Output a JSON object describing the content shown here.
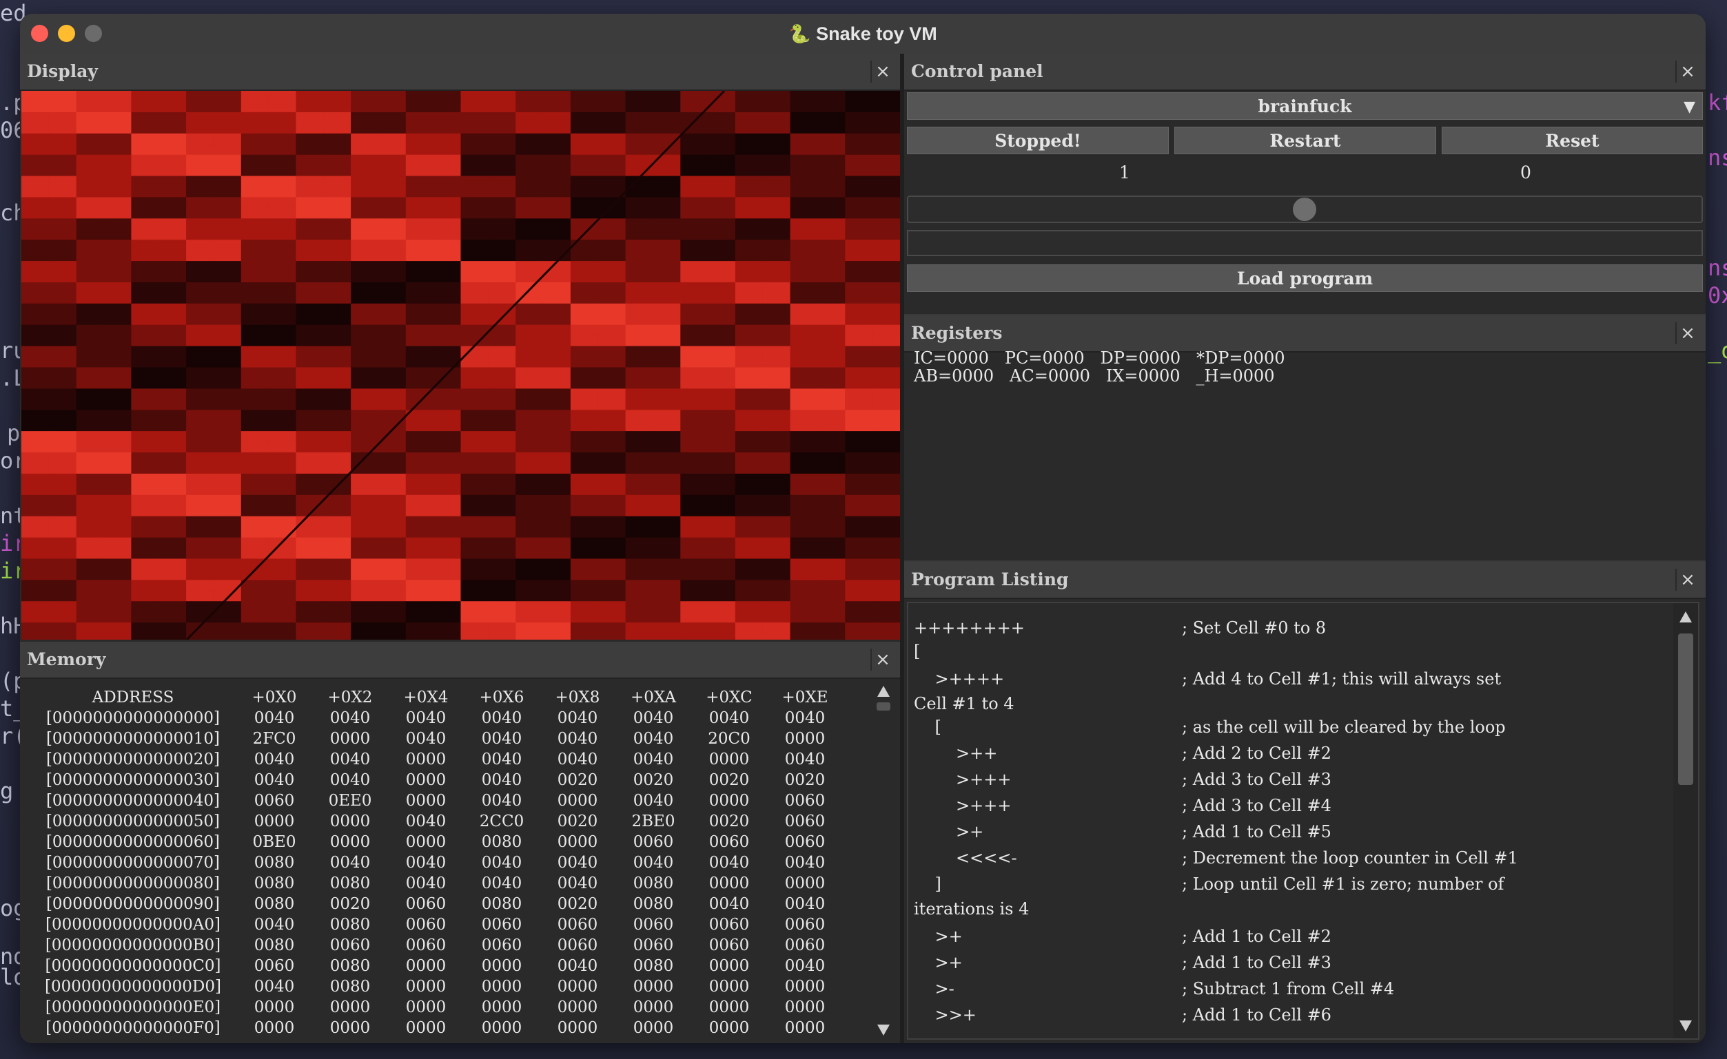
{
  "background_editor": {
    "fragments": [
      "ed",
      ".p",
      "06",
      "ch",
      "ru",
      ".L",
      "p",
      "or",
      "nt",
      "ir",
      "ir",
      "hH",
      "(p",
      "t_",
      "r(",
      "g",
      "og",
      "nd",
      "lo"
    ],
    "right_fragments": [
      "kf",
      "ns",
      "ns",
      "0x",
      "_o"
    ]
  },
  "window": {
    "title": "Snake toy VM",
    "title_icon": "snake-icon"
  },
  "display": {
    "title": "Display",
    "close_label": "×",
    "heatmap_colors": [
      "#160404",
      "#2a0606",
      "#4a0a08",
      "#7a100c",
      "#a8170f",
      "#d42a1f",
      "#e8382a"
    ]
  },
  "control_panel": {
    "title": "Control panel",
    "close_label": "×",
    "language_select": "brainfuck",
    "buttons": {
      "stopped": "Stopped!",
      "restart": "Restart",
      "reset": "Reset"
    },
    "left_value": "1",
    "right_value": "0",
    "slider_value": 0.5,
    "load_program": "Load program"
  },
  "registers": {
    "title": "Registers",
    "close_label": "×",
    "line1": "IC=0000   PC=0000   DP=0000   *DP=0000",
    "line2": "AB=0000   AC=0000   IX=0000   _H=0000"
  },
  "listing": {
    "title": "Program Listing",
    "close_label": "×",
    "lines": [
      {
        "code": "++++++++",
        "comment": "; Set Cell #0 to 8"
      },
      {
        "code": "[",
        "comment": ""
      },
      {
        "code": "    >++++",
        "comment": "; Add 4 to Cell #1; this will always set"
      },
      {
        "code": "Cell #1 to 4",
        "comment": ""
      },
      {
        "code": "    [",
        "comment": "; as the cell will be cleared by the loop"
      },
      {
        "code": "        >++",
        "comment": "; Add 2 to Cell #2"
      },
      {
        "code": "        >+++",
        "comment": "; Add 3 to Cell #3"
      },
      {
        "code": "        >+++",
        "comment": "; Add 3 to Cell #4"
      },
      {
        "code": "        >+",
        "comment": "; Add 1 to Cell #5"
      },
      {
        "code": "        <<<<-",
        "comment": "; Decrement the loop counter in Cell #1"
      },
      {
        "code": "    ]",
        "comment": "; Loop until Cell #1 is zero; number of"
      },
      {
        "code": "iterations is 4",
        "comment": ""
      },
      {
        "code": "    >+",
        "comment": "; Add 1 to Cell #2"
      },
      {
        "code": "    >+",
        "comment": "; Add 1 to Cell #3"
      },
      {
        "code": "    >-",
        "comment": "; Subtract 1 from Cell #4"
      },
      {
        "code": "    >>+",
        "comment": "; Add 1 to Cell #6"
      }
    ]
  },
  "memory": {
    "title": "Memory",
    "close_label": "×",
    "headers": [
      "ADDRESS",
      "+0X0",
      "+0X2",
      "+0X4",
      "+0X6",
      "+0X8",
      "+0XA",
      "+0XC",
      "+0XE"
    ],
    "rows": [
      [
        "[0000000000000000]",
        "0040",
        "0040",
        "0040",
        "0040",
        "0040",
        "0040",
        "0040",
        "0040"
      ],
      [
        "[0000000000000010]",
        "2FC0",
        "0000",
        "0040",
        "0040",
        "0040",
        "0040",
        "20C0",
        "0000"
      ],
      [
        "[0000000000000020]",
        "0040",
        "0040",
        "0000",
        "0040",
        "0040",
        "0040",
        "0000",
        "0040"
      ],
      [
        "[0000000000000030]",
        "0040",
        "0040",
        "0000",
        "0040",
        "0020",
        "0020",
        "0020",
        "0020"
      ],
      [
        "[0000000000000040]",
        "0060",
        "0EE0",
        "0000",
        "0040",
        "0000",
        "0040",
        "0000",
        "0060"
      ],
      [
        "[0000000000000050]",
        "0000",
        "0000",
        "0040",
        "2CC0",
        "0020",
        "2BE0",
        "0020",
        "0060"
      ],
      [
        "[0000000000000060]",
        "0BE0",
        "0000",
        "0000",
        "0080",
        "0000",
        "0060",
        "0060",
        "0060"
      ],
      [
        "[0000000000000070]",
        "0080",
        "0040",
        "0040",
        "0040",
        "0040",
        "0040",
        "0040",
        "0040"
      ],
      [
        "[0000000000000080]",
        "0080",
        "0080",
        "0040",
        "0040",
        "0040",
        "0080",
        "0000",
        "0000"
      ],
      [
        "[0000000000000090]",
        "0080",
        "0020",
        "0060",
        "0080",
        "0020",
        "0080",
        "0040",
        "0040"
      ],
      [
        "[00000000000000A0]",
        "0040",
        "0080",
        "0060",
        "0060",
        "0060",
        "0060",
        "0060",
        "0060"
      ],
      [
        "[00000000000000B0]",
        "0080",
        "0060",
        "0060",
        "0060",
        "0060",
        "0060",
        "0060",
        "0060"
      ],
      [
        "[00000000000000C0]",
        "0060",
        "0080",
        "0000",
        "0000",
        "0040",
        "0080",
        "0000",
        "0040"
      ],
      [
        "[00000000000000D0]",
        "0040",
        "0080",
        "0000",
        "0000",
        "0000",
        "0000",
        "0000",
        "0000"
      ],
      [
        "[00000000000000E0]",
        "0000",
        "0000",
        "0000",
        "0000",
        "0000",
        "0000",
        "0000",
        "0000"
      ],
      [
        "[00000000000000F0]",
        "0000",
        "0000",
        "0000",
        "0000",
        "0000",
        "0000",
        "0000",
        "0000"
      ]
    ]
  }
}
